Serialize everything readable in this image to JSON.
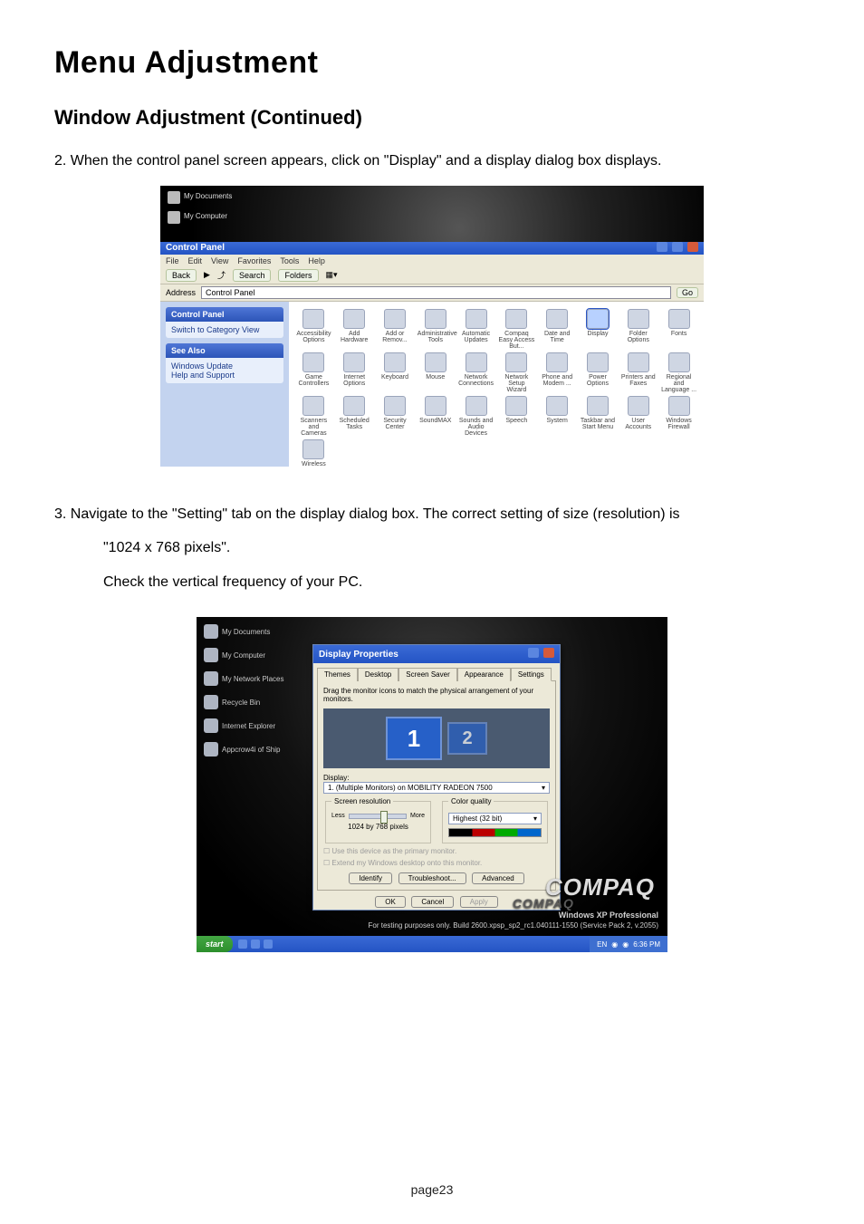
{
  "doc": {
    "title": "Menu Adjustment",
    "subtitle": "Window Adjustment (Continued)",
    "step2": "2. When the control panel screen appears, click on \"Display\" and a display dialog box displays.",
    "step3a": "3. Navigate to the \"Setting\" tab on the display dialog box. The correct setting of size (resolution) is",
    "step3b": "\"1024 x 768 pixels\".",
    "step3c": "Check the vertical frequency of your PC.",
    "pagenum": "page23"
  },
  "ss1": {
    "desktop": {
      "my_documents": "My Documents",
      "my_computer": "My Computer"
    },
    "window_title": "Control Panel",
    "menu": [
      "File",
      "Edit",
      "View",
      "Favorites",
      "Tools",
      "Help"
    ],
    "toolbar": {
      "back": "Back",
      "search": "Search",
      "folders": "Folders"
    },
    "address": {
      "label": "Address",
      "value": "Control Panel",
      "go": "Go"
    },
    "sidebar": {
      "cp_header": "Control Panel",
      "switch_view": "Switch to Category View",
      "see_also_header": "See Also",
      "see_also": [
        "Windows Update",
        "Help and Support"
      ]
    },
    "items": [
      "Accessibility Options",
      "Add Hardware",
      "Add or Remov...",
      "Administrative Tools",
      "Automatic Updates",
      "Compaq Easy Access But...",
      "Date and Time",
      "Display",
      "Folder Options",
      "Fonts",
      "Game Controllers",
      "Internet Options",
      "Keyboard",
      "Mouse",
      "Network Connections",
      "Network Setup Wizard",
      "Phone and Modem ...",
      "Power Options",
      "Printers and Faxes",
      "Regional and Language ...",
      "Scanners and Cameras",
      "Scheduled Tasks",
      "Security Center",
      "SoundMAX",
      "Sounds and Audio Devices",
      "Speech",
      "System",
      "Taskbar and Start Menu",
      "User Accounts",
      "Windows Firewall",
      "Wireless Link"
    ],
    "selected": "Display"
  },
  "ss2": {
    "desktop": [
      "My Documents",
      "My Computer",
      "My Network Places",
      "Recycle Bin",
      "Internet Explorer",
      "Appcrow4i of Ship"
    ],
    "brand": "COMPAQ",
    "brand_shadow": "COMPAQ",
    "watermark": {
      "title": "Windows XP Professional",
      "sub": "For testing purposes only. Build 2600.xpsp_sp2_rc1.040111-1550 (Service Pack 2, v.2055)"
    },
    "taskbar": {
      "start": "start",
      "clock": "6:36 PM",
      "lang": "EN"
    },
    "dlg": {
      "title": "Display Properties",
      "tabs": [
        "Themes",
        "Desktop",
        "Screen Saver",
        "Appearance",
        "Settings"
      ],
      "drag_hint": "Drag the monitor icons to match the physical arrangement of your monitors.",
      "mon1": "1",
      "mon2": "2",
      "display_label": "Display:",
      "display_value": "1. (Multiple Monitors) on MOBILITY RADEON 7500",
      "sr_legend": "Screen resolution",
      "sr_less": "Less",
      "sr_more": "More",
      "sr_value": "1024 by 768 pixels",
      "cq_legend": "Color quality",
      "cq_value": "Highest (32 bit)",
      "chk1": "Use this device as the primary monitor.",
      "chk2": "Extend my Windows desktop onto this monitor.",
      "btn_identify": "Identify",
      "btn_troubleshoot": "Troubleshoot...",
      "btn_advanced": "Advanced",
      "btn_ok": "OK",
      "btn_cancel": "Cancel",
      "btn_apply": "Apply"
    }
  }
}
